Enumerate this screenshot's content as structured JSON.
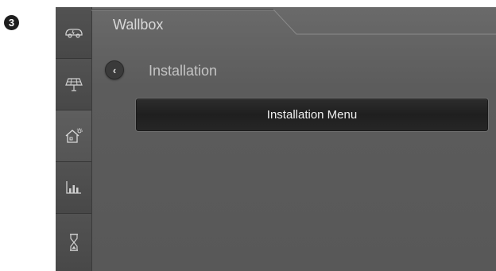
{
  "step": {
    "number": "3"
  },
  "header": {
    "title": "Wallbox"
  },
  "sidebar": {
    "items": [
      {
        "icon": "ev-car-icon"
      },
      {
        "icon": "solar-panel-icon"
      },
      {
        "icon": "home-energy-icon"
      },
      {
        "icon": "bar-chart-icon"
      },
      {
        "icon": "hourglass-icon"
      }
    ]
  },
  "section": {
    "title": "Installation",
    "back_glyph": "‹"
  },
  "menu": {
    "installation_menu_label": "Installation Menu"
  }
}
